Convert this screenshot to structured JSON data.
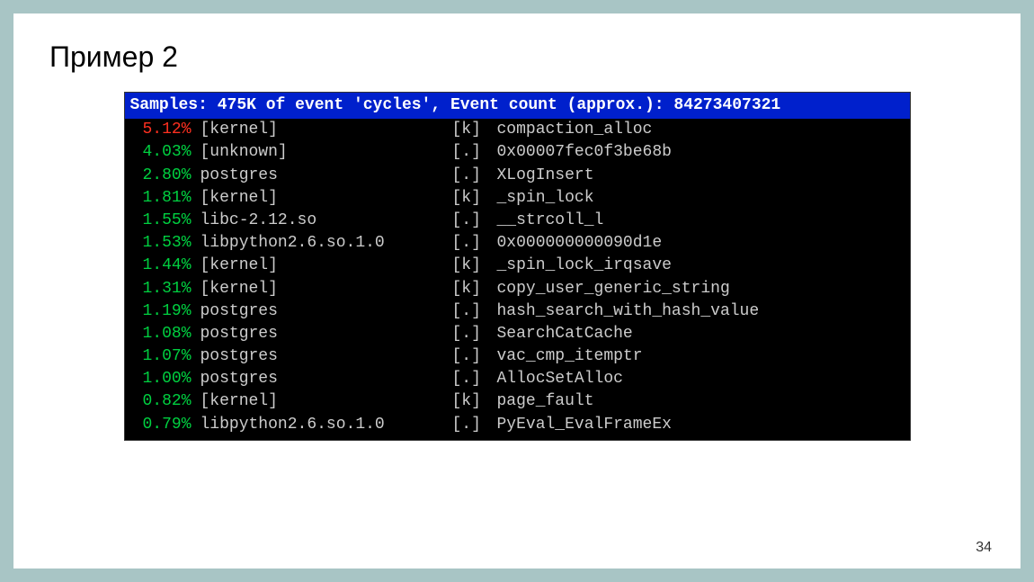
{
  "slide": {
    "title": "Пример 2",
    "page_number": "34"
  },
  "perf": {
    "header": "Samples: 475K of event 'cycles', Event count (approx.): 84273407321",
    "rows": [
      {
        "pct": "5.12%",
        "pct_class": "pct-red",
        "obj": "[kernel]",
        "type": "[k]",
        "sym": "compaction_alloc"
      },
      {
        "pct": "4.03%",
        "pct_class": "pct-green",
        "obj": "[unknown]",
        "type": "[.]",
        "sym": "0x00007fec0f3be68b"
      },
      {
        "pct": "2.80%",
        "pct_class": "pct-green",
        "obj": "postgres",
        "type": "[.]",
        "sym": "XLogInsert"
      },
      {
        "pct": "1.81%",
        "pct_class": "pct-green",
        "obj": "[kernel]",
        "type": "[k]",
        "sym": "_spin_lock"
      },
      {
        "pct": "1.55%",
        "pct_class": "pct-green",
        "obj": "libc-2.12.so",
        "type": "[.]",
        "sym": "__strcoll_l"
      },
      {
        "pct": "1.53%",
        "pct_class": "pct-green",
        "obj": "libpython2.6.so.1.0",
        "type": "[.]",
        "sym": "0x000000000090d1e"
      },
      {
        "pct": "1.44%",
        "pct_class": "pct-green",
        "obj": "[kernel]",
        "type": "[k]",
        "sym": "_spin_lock_irqsave"
      },
      {
        "pct": "1.31%",
        "pct_class": "pct-green",
        "obj": "[kernel]",
        "type": "[k]",
        "sym": "copy_user_generic_string"
      },
      {
        "pct": "1.19%",
        "pct_class": "pct-green",
        "obj": "postgres",
        "type": "[.]",
        "sym": "hash_search_with_hash_value"
      },
      {
        "pct": "1.08%",
        "pct_class": "pct-green",
        "obj": "postgres",
        "type": "[.]",
        "sym": "SearchCatCache"
      },
      {
        "pct": "1.07%",
        "pct_class": "pct-green",
        "obj": "postgres",
        "type": "[.]",
        "sym": "vac_cmp_itemptr"
      },
      {
        "pct": "1.00%",
        "pct_class": "pct-green",
        "obj": "postgres",
        "type": "[.]",
        "sym": "AllocSetAlloc"
      },
      {
        "pct": "0.82%",
        "pct_class": "pct-green",
        "obj": "[kernel]",
        "type": "[k]",
        "sym": "page_fault"
      },
      {
        "pct": "0.79%",
        "pct_class": "pct-green",
        "obj": "libpython2.6.so.1.0",
        "type": "[.]",
        "sym": "PyEval_EvalFrameEx"
      }
    ]
  }
}
